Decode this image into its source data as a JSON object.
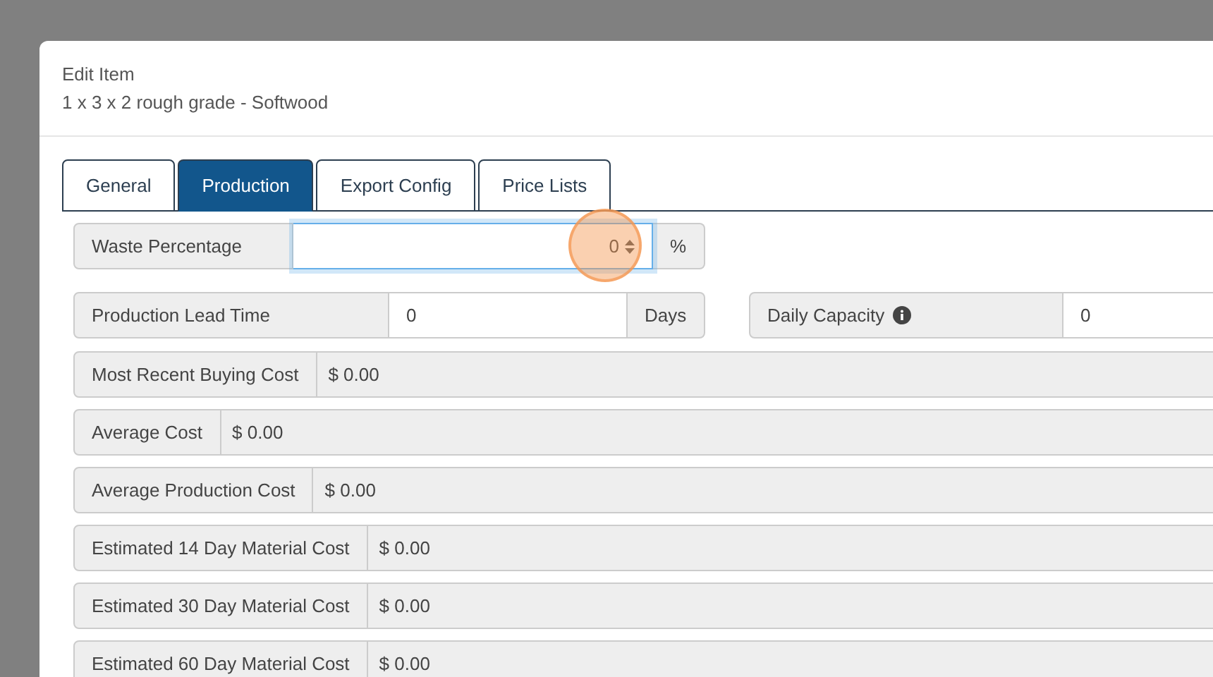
{
  "dialog": {
    "title": "Edit Item",
    "subtitle": "1 x 3 x 2 rough grade - Softwood"
  },
  "tabs": [
    {
      "label": "General",
      "selected": false
    },
    {
      "label": "Production",
      "selected": true
    },
    {
      "label": "Export Config",
      "selected": false
    },
    {
      "label": "Price Lists",
      "selected": false
    }
  ],
  "waste": {
    "label": "Waste Percentage",
    "value": "0",
    "unit": "%",
    "focused": true
  },
  "lead_time": {
    "label": "Production Lead Time",
    "value": "0",
    "unit": "Days"
  },
  "daily_capacity": {
    "label": "Daily Capacity",
    "value": "0"
  },
  "costs": [
    {
      "label": "Most Recent Buying Cost",
      "value": "$ 0.00"
    },
    {
      "label": "Average Cost",
      "value": "$ 0.00"
    },
    {
      "label": "Average Production Cost",
      "value": "$ 0.00"
    },
    {
      "label": "Estimated 14 Day Material Cost",
      "value": "$ 0.00"
    },
    {
      "label": "Estimated 30 Day Material Cost",
      "value": "$ 0.00"
    },
    {
      "label": "Estimated 60 Day Material Cost",
      "value": "$ 0.00"
    }
  ]
}
